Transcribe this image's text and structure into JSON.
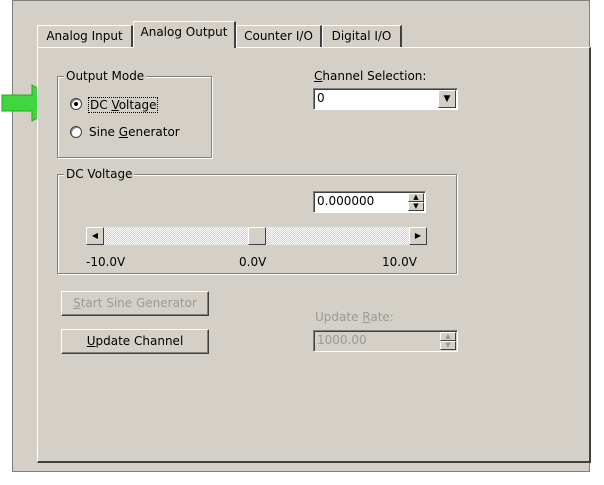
{
  "tabs": [
    {
      "label": "Analog Input"
    },
    {
      "label": "Analog Output"
    },
    {
      "label": "Counter I/O"
    },
    {
      "label": "Digital I/O"
    }
  ],
  "output_mode": {
    "group_label": "Output Mode",
    "options": [
      {
        "pre": "DC ",
        "u": "V",
        "post": "oltage",
        "selected": true
      },
      {
        "pre": "Sine ",
        "u": "G",
        "post": "enerator",
        "selected": false
      }
    ]
  },
  "channel": {
    "label_u": "C",
    "label_rest": "hannel Selection:",
    "value": "0"
  },
  "dc_voltage": {
    "group_label": "DC Voltage",
    "value": "0.000000",
    "slider_min_label": "-10.0V",
    "slider_mid_label": "0.0V",
    "slider_max_label": "10.0V",
    "slider_level": 0.5
  },
  "start_sine": {
    "u": "S",
    "rest": "tart Sine Generator"
  },
  "update_channel": {
    "u": "U",
    "rest": "pdate Channel"
  },
  "update_rate": {
    "label_pre": "Update ",
    "label_u": "R",
    "label_post": "ate:",
    "value": "1000.00"
  },
  "annotation": {
    "color": "#3fd63f",
    "icon": "arrow-right-icon"
  }
}
